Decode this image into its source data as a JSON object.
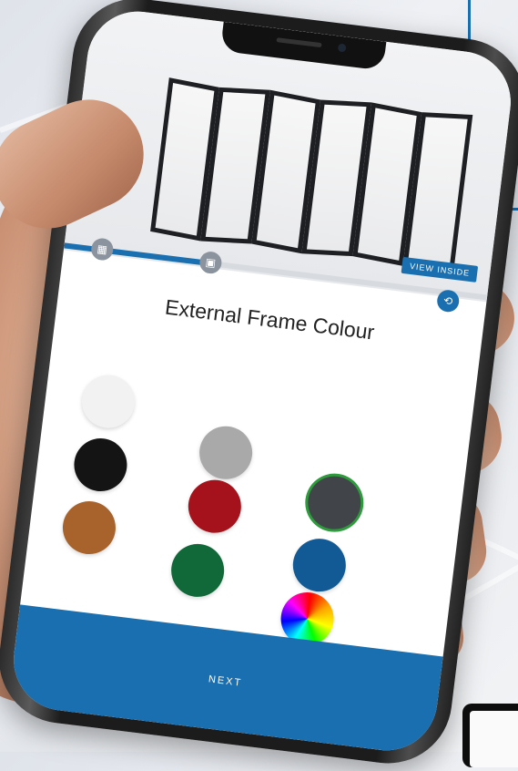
{
  "app": {
    "progress_percent": 33,
    "view_inside_label": "VIEW INSIDE",
    "section_title": "External Frame Colour",
    "next_label": "NEXT"
  },
  "icons": {
    "step1": "panel-layout-icon",
    "step2": "glazing-icon",
    "view_inside": "camera-swap-icon"
  },
  "colours": {
    "accent": "#1a6fb0",
    "selected_ring": "#2e9b3c"
  },
  "swatches": [
    {
      "name": "white",
      "color": "#f2f2f2"
    },
    {
      "name": "grey",
      "color": "#a9a9a9"
    },
    {
      "name": "black",
      "color": "#141414"
    },
    {
      "name": "dark-grey",
      "color": "#414449",
      "selected": true
    },
    {
      "name": "red",
      "color": "#a5121b"
    },
    {
      "name": "brown",
      "color": "#a8622b"
    },
    {
      "name": "blue",
      "color": "#125a95"
    },
    {
      "name": "green",
      "color": "#11693a"
    },
    {
      "name": "custom",
      "color": "conic-gradient"
    }
  ]
}
